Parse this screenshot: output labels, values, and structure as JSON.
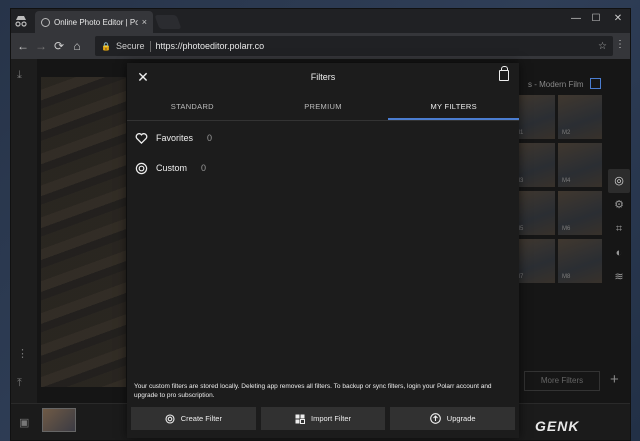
{
  "browser": {
    "tab_title": "Online Photo Editor | Pola",
    "tab_close": "×",
    "secure_label": "Secure",
    "url": "https://photoeditor.polarr.co",
    "nav_back": "←",
    "nav_forward": "→",
    "nav_reload": "⟳",
    "nav_home": "⌂",
    "bookmark_star": "☆",
    "menu": "⋮",
    "window_min": "—",
    "window_max": "☐",
    "window_close": "✕"
  },
  "modal": {
    "title": "Filters",
    "close_glyph": "✕",
    "tabs": [
      {
        "label": "STANDARD",
        "active": false
      },
      {
        "label": "PREMIUM",
        "active": false
      },
      {
        "label": "MY FILTERS",
        "active": true
      }
    ],
    "rows": [
      {
        "label": "Favorites",
        "count": "0",
        "icon": "heart-icon"
      },
      {
        "label": "Custom",
        "count": "0",
        "icon": "custom-filter-icon"
      }
    ],
    "notice": "Your custom filters are stored locally. Deleting app removes all filters. To backup or sync filters, login your Polarr account and upgrade to pro subscription.",
    "actions": [
      {
        "label": "Create Filter",
        "icon": "create-filter-icon"
      },
      {
        "label": "Import Filter",
        "icon": "import-filter-icon"
      },
      {
        "label": "Upgrade",
        "icon": "upgrade-arrow-icon"
      }
    ]
  },
  "right_panel": {
    "title": "s - Modern Film",
    "thumb_labels": [
      "M1",
      "M2",
      "M3",
      "M4",
      "M5",
      "M6",
      "M7",
      "M8"
    ],
    "more_filters": "More Filters",
    "add": "+"
  },
  "watermark": "GENK",
  "colors": {
    "accent": "#4b7dd0",
    "modal_bg": "#1c1c1c",
    "button_bg": "#313131"
  }
}
